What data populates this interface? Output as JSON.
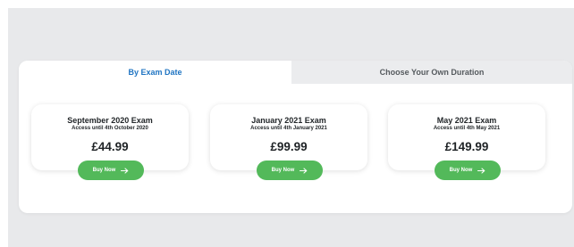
{
  "tabs": [
    {
      "label": "By Exam Date",
      "active": true
    },
    {
      "label": "Choose Your Own Duration",
      "active": false
    }
  ],
  "cards": [
    {
      "title": "September 2020 Exam",
      "access": "Access until 4th October 2020",
      "price": "£44.99",
      "button": "Buy Now"
    },
    {
      "title": "January 2021 Exam",
      "access": "Access until 4th January 2021",
      "price": "£99.99",
      "button": "Buy Now"
    },
    {
      "title": "May 2021 Exam",
      "access": "Access until 4th May 2021",
      "price": "£149.99",
      "button": "Buy Now"
    }
  ],
  "colors": {
    "accent_blue": "#1f74c2",
    "button_green": "#53b95a",
    "background": "#e8e9eb"
  },
  "icons": {
    "button": "arrow-right-icon"
  }
}
